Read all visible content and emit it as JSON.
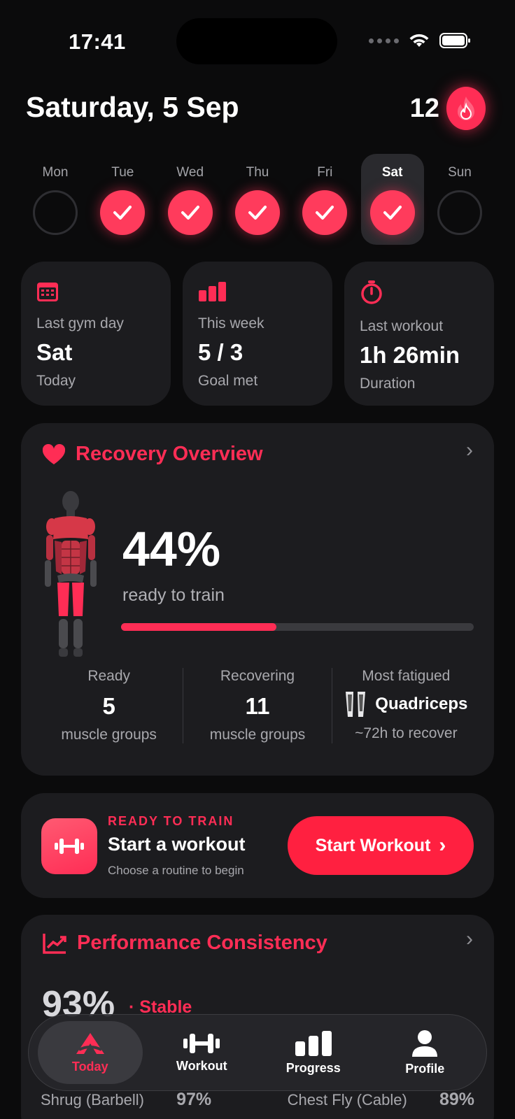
{
  "status_bar": {
    "time": "17:41"
  },
  "header": {
    "date": "Saturday, 5 Sep",
    "streak_count": "12"
  },
  "week": [
    {
      "label": "Mon",
      "done": false,
      "selected": false
    },
    {
      "label": "Tue",
      "done": true,
      "selected": false
    },
    {
      "label": "Wed",
      "done": true,
      "selected": false
    },
    {
      "label": "Thu",
      "done": true,
      "selected": false
    },
    {
      "label": "Fri",
      "done": true,
      "selected": false
    },
    {
      "label": "Sat",
      "done": true,
      "selected": true
    },
    {
      "label": "Sun",
      "done": false,
      "selected": false
    }
  ],
  "stats": {
    "last_gym": {
      "label": "Last gym day",
      "value": "Sat",
      "sub": "Today",
      "icon": "calendar-icon"
    },
    "this_week": {
      "label": "This week",
      "value": "5 / 3",
      "sub": "Goal met",
      "icon": "bar-chart-icon"
    },
    "last_workout": {
      "label": "Last workout",
      "value": "1h 26min",
      "sub": "Duration",
      "icon": "stopwatch-icon"
    }
  },
  "recovery": {
    "title": "Recovery Overview",
    "percent": "44%",
    "percent_value": 0.44,
    "subtitle": "ready to train",
    "ready": {
      "label": "Ready",
      "value": "5",
      "sub": "muscle groups"
    },
    "recovering": {
      "label": "Recovering",
      "value": "11",
      "sub": "muscle groups"
    },
    "fatigued": {
      "label": "Most fatigued",
      "value": "Quadriceps",
      "sub": "~72h to recover"
    }
  },
  "start": {
    "eyebrow": "READY TO TRAIN",
    "title": "Start a workout",
    "subtitle": "Choose a routine to begin",
    "button": "Start Workout"
  },
  "performance": {
    "title": "Performance Consistency",
    "percent": "93%",
    "status": "· Stable",
    "rows": [
      {
        "name": "Shrug (Barbell)",
        "value": "97%"
      },
      {
        "name": "Chest Fly (Cable)",
        "value": "89%"
      }
    ]
  },
  "tabs": [
    {
      "label": "Today",
      "active": true,
      "icon": "today-logo-icon"
    },
    {
      "label": "Workout",
      "active": false,
      "icon": "dumbbell-icon"
    },
    {
      "label": "Progress",
      "active": false,
      "icon": "bars-icon"
    },
    {
      "label": "Profile",
      "active": false,
      "icon": "person-icon"
    }
  ],
  "colors": {
    "accent": "#ff2d55",
    "background": "#0b0b0c",
    "card": "#1c1c1f"
  }
}
